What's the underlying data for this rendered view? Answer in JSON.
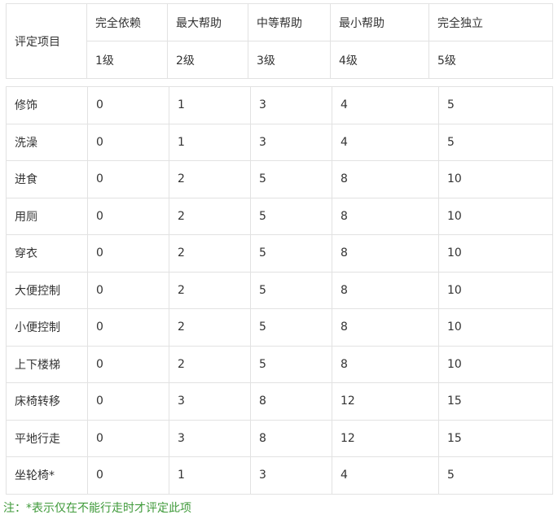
{
  "header": {
    "item_label": "评定项目",
    "columns": [
      {
        "name": "完全依赖",
        "grade": "1级"
      },
      {
        "name": "最大帮助",
        "grade": "2级"
      },
      {
        "name": "中等帮助",
        "grade": "3级"
      },
      {
        "name": "最小帮助",
        "grade": "4级"
      },
      {
        "name": "完全独立",
        "grade": "5级"
      }
    ]
  },
  "rows": [
    {
      "item": "修饰",
      "scores": [
        "0",
        "1",
        "3",
        "4",
        "5"
      ]
    },
    {
      "item": "洗澡",
      "scores": [
        "0",
        "1",
        "3",
        "4",
        "5"
      ]
    },
    {
      "item": "进食",
      "scores": [
        "0",
        "2",
        "5",
        "8",
        "10"
      ]
    },
    {
      "item": "用厕",
      "scores": [
        "0",
        "2",
        "5",
        "8",
        "10"
      ]
    },
    {
      "item": "穿衣",
      "scores": [
        "0",
        "2",
        "5",
        "8",
        "10"
      ]
    },
    {
      "item": "大便控制",
      "scores": [
        "0",
        "2",
        "5",
        "8",
        "10"
      ]
    },
    {
      "item": "小便控制",
      "scores": [
        "0",
        "2",
        "5",
        "8",
        "10"
      ]
    },
    {
      "item": "上下楼梯",
      "scores": [
        "0",
        "2",
        "5",
        "8",
        "10"
      ]
    },
    {
      "item": "床椅转移",
      "scores": [
        "0",
        "3",
        "8",
        "12",
        "15"
      ]
    },
    {
      "item": "平地行走",
      "scores": [
        "0",
        "3",
        "8",
        "12",
        "15"
      ]
    },
    {
      "item": "坐轮椅*",
      "scores": [
        "0",
        "1",
        "3",
        "4",
        "5"
      ]
    }
  ],
  "note": "注：*表示仅在不能行走时才评定此项",
  "colors": {
    "border": "#e2e2e2",
    "text": "#333333",
    "note": "#3f9a3a"
  }
}
